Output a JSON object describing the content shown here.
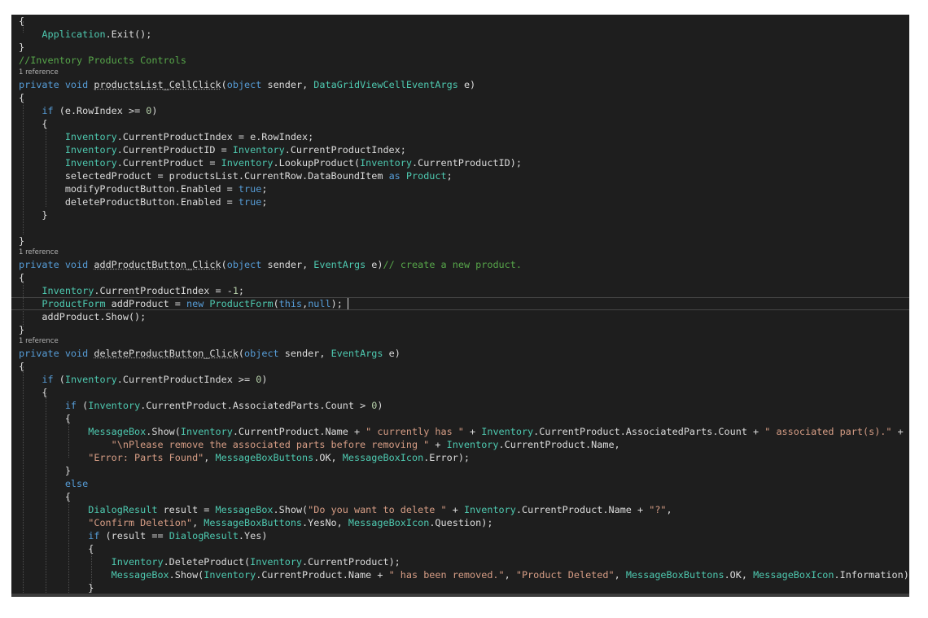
{
  "editor": {
    "references_label": "1 reference",
    "lines": [
      [
        [
          "{",
          "p"
        ]
      ],
      [
        [
          "    ",
          "p"
        ],
        [
          "Application",
          "ty"
        ],
        [
          ".Exit();",
          "p"
        ]
      ],
      [
        [
          "}",
          "p"
        ]
      ],
      [
        [
          "//Inventory Products Controls",
          "cm"
        ]
      ],
      [
        [
          "private",
          "kw"
        ],
        [
          " ",
          "p"
        ],
        [
          "void",
          "kw"
        ],
        [
          " ",
          "p"
        ],
        [
          "productsList_CellClick",
          "ul"
        ],
        [
          "(",
          "p"
        ],
        [
          "object",
          "kw"
        ],
        [
          " sender, ",
          "p"
        ],
        [
          "DataGridViewCellEventArgs",
          "ty"
        ],
        [
          " e)",
          "p"
        ]
      ],
      [
        [
          "{",
          "p"
        ]
      ],
      [
        [
          "    ",
          "p"
        ],
        [
          "if",
          "kw"
        ],
        [
          " (e.RowIndex >= ",
          "p"
        ],
        [
          "0",
          "nu"
        ],
        [
          ")",
          "p"
        ]
      ],
      [
        [
          "    {",
          "p"
        ]
      ],
      [
        [
          "        ",
          "p"
        ],
        [
          "Inventory",
          "ty"
        ],
        [
          ".CurrentProductIndex = e.RowIndex;",
          "p"
        ]
      ],
      [
        [
          "        ",
          "p"
        ],
        [
          "Inventory",
          "ty"
        ],
        [
          ".CurrentProductID = ",
          "p"
        ],
        [
          "Inventory",
          "ty"
        ],
        [
          ".CurrentProductIndex;",
          "p"
        ]
      ],
      [
        [
          "        ",
          "p"
        ],
        [
          "Inventory",
          "ty"
        ],
        [
          ".CurrentProduct = ",
          "p"
        ],
        [
          "Inventory",
          "ty"
        ],
        [
          ".LookupProduct(",
          "p"
        ],
        [
          "Inventory",
          "ty"
        ],
        [
          ".CurrentProductID);",
          "p"
        ]
      ],
      [
        [
          "        selectedProduct = productsList.CurrentRow.DataBoundItem ",
          "p"
        ],
        [
          "as",
          "kw"
        ],
        [
          " ",
          "p"
        ],
        [
          "Product",
          "ty"
        ],
        [
          ";",
          "p"
        ]
      ],
      [
        [
          "        modifyProductButton.Enabled = ",
          "p"
        ],
        [
          "true",
          "kw"
        ],
        [
          ";",
          "p"
        ]
      ],
      [
        [
          "        deleteProductButton.Enabled = ",
          "p"
        ],
        [
          "true",
          "kw"
        ],
        [
          ";",
          "p"
        ]
      ],
      [
        [
          "    }",
          "p"
        ]
      ],
      [
        [
          "",
          "p"
        ]
      ],
      [
        [
          "",
          "p"
        ]
      ],
      [
        [
          "}",
          "p"
        ]
      ],
      [
        [
          "private",
          "kw"
        ],
        [
          " ",
          "p"
        ],
        [
          "void",
          "kw"
        ],
        [
          " ",
          "p"
        ],
        [
          "addProductButton_Click",
          "ul"
        ],
        [
          "(",
          "p"
        ],
        [
          "object",
          "kw"
        ],
        [
          " sender, ",
          "p"
        ],
        [
          "EventArgs",
          "ty"
        ],
        [
          " e)",
          "p"
        ],
        [
          "// create a new product.",
          "cm"
        ]
      ],
      [
        [
          "{",
          "p"
        ]
      ],
      [
        [
          "    ",
          "p"
        ],
        [
          "Inventory",
          "ty"
        ],
        [
          ".CurrentProductIndex = -",
          "p"
        ],
        [
          "1",
          "nu"
        ],
        [
          ";",
          "p"
        ]
      ],
      [
        [
          "    ",
          "p"
        ],
        [
          "ProductForm",
          "ty"
        ],
        [
          " addProduct = ",
          "p"
        ],
        [
          "new",
          "kw"
        ],
        [
          " ",
          "p"
        ],
        [
          "ProductForm",
          "ty"
        ],
        [
          "(",
          "p"
        ],
        [
          "this",
          "kw"
        ],
        [
          ",",
          "p"
        ],
        [
          "null",
          "kw"
        ],
        [
          ");",
          "p"
        ]
      ],
      [
        [
          "    addProduct.Show();",
          "p"
        ]
      ],
      [
        [
          "}",
          "p"
        ]
      ],
      [
        [
          "private",
          "kw"
        ],
        [
          " ",
          "p"
        ],
        [
          "void",
          "kw"
        ],
        [
          " ",
          "p"
        ],
        [
          "deleteProductButton_Click",
          "ul"
        ],
        [
          "(",
          "p"
        ],
        [
          "object",
          "kw"
        ],
        [
          " sender, ",
          "p"
        ],
        [
          "EventArgs",
          "ty"
        ],
        [
          " e)",
          "p"
        ]
      ],
      [
        [
          "{",
          "p"
        ]
      ],
      [
        [
          "    ",
          "p"
        ],
        [
          "if",
          "kw"
        ],
        [
          " (",
          "p"
        ],
        [
          "Inventory",
          "ty"
        ],
        [
          ".CurrentProductIndex >= ",
          "p"
        ],
        [
          "0",
          "nu"
        ],
        [
          ")",
          "p"
        ]
      ],
      [
        [
          "    {",
          "p"
        ]
      ],
      [
        [
          "        ",
          "p"
        ],
        [
          "if",
          "kw"
        ],
        [
          " (",
          "p"
        ],
        [
          "Inventory",
          "ty"
        ],
        [
          ".CurrentProduct.AssociatedParts.Count > ",
          "p"
        ],
        [
          "0",
          "nu"
        ],
        [
          ")",
          "p"
        ]
      ],
      [
        [
          "        {",
          "p"
        ]
      ],
      [
        [
          "            ",
          "p"
        ],
        [
          "MessageBox",
          "ty"
        ],
        [
          ".Show(",
          "p"
        ],
        [
          "Inventory",
          "ty"
        ],
        [
          ".CurrentProduct.Name + ",
          "p"
        ],
        [
          "\" currently has \"",
          "st"
        ],
        [
          " + ",
          "p"
        ],
        [
          "Inventory",
          "ty"
        ],
        [
          ".CurrentProduct.AssociatedParts.Count + ",
          "p"
        ],
        [
          "\" associated part(s).\"",
          "st"
        ],
        [
          " +",
          "p"
        ]
      ],
      [
        [
          "                ",
          "p"
        ],
        [
          "\"\\nPlease remove the associated parts before removing \"",
          "st"
        ],
        [
          " + ",
          "p"
        ],
        [
          "Inventory",
          "ty"
        ],
        [
          ".CurrentProduct.Name,",
          "p"
        ]
      ],
      [
        [
          "            ",
          "p"
        ],
        [
          "\"Error: Parts Found\"",
          "st"
        ],
        [
          ", ",
          "p"
        ],
        [
          "MessageBoxButtons",
          "ty"
        ],
        [
          ".OK, ",
          "p"
        ],
        [
          "MessageBoxIcon",
          "ty"
        ],
        [
          ".Error);",
          "p"
        ]
      ],
      [
        [
          "        }",
          "p"
        ]
      ],
      [
        [
          "        ",
          "p"
        ],
        [
          "else",
          "kw"
        ]
      ],
      [
        [
          "        {",
          "p"
        ]
      ],
      [
        [
          "            ",
          "p"
        ],
        [
          "DialogResult",
          "ty"
        ],
        [
          " result = ",
          "p"
        ],
        [
          "MessageBox",
          "ty"
        ],
        [
          ".Show(",
          "p"
        ],
        [
          "\"Do you want to delete \"",
          "st"
        ],
        [
          " + ",
          "p"
        ],
        [
          "Inventory",
          "ty"
        ],
        [
          ".CurrentProduct.Name + ",
          "p"
        ],
        [
          "\"?\"",
          "st"
        ],
        [
          ",",
          "p"
        ]
      ],
      [
        [
          "            ",
          "p"
        ],
        [
          "\"Confirm Deletion\"",
          "st"
        ],
        [
          ", ",
          "p"
        ],
        [
          "MessageBoxButtons",
          "ty"
        ],
        [
          ".YesNo, ",
          "p"
        ],
        [
          "MessageBoxIcon",
          "ty"
        ],
        [
          ".Question);",
          "p"
        ]
      ],
      [
        [
          "            ",
          "p"
        ],
        [
          "if",
          "kw"
        ],
        [
          " (result == ",
          "p"
        ],
        [
          "DialogResult",
          "ty"
        ],
        [
          ".Yes)",
          "p"
        ]
      ],
      [
        [
          "            {",
          "p"
        ]
      ],
      [
        [
          "                ",
          "p"
        ],
        [
          "Inventory",
          "ty"
        ],
        [
          ".DeleteProduct(",
          "p"
        ],
        [
          "Inventory",
          "ty"
        ],
        [
          ".CurrentProduct);",
          "p"
        ]
      ],
      [
        [
          "                ",
          "p"
        ],
        [
          "MessageBox",
          "ty"
        ],
        [
          ".Show(",
          "p"
        ],
        [
          "Inventory",
          "ty"
        ],
        [
          ".CurrentProduct.Name + ",
          "p"
        ],
        [
          "\" has been removed.\"",
          "st"
        ],
        [
          ", ",
          "p"
        ],
        [
          "\"Product Deleted\"",
          "st"
        ],
        [
          ", ",
          "p"
        ],
        [
          "MessageBoxButtons",
          "ty"
        ],
        [
          ".OK, ",
          "p"
        ],
        [
          "MessageBoxIcon",
          "ty"
        ],
        [
          ".Information);",
          "p"
        ]
      ],
      [
        [
          "            }",
          "p"
        ]
      ]
    ]
  },
  "colors": {
    "background": "#1e1e1e",
    "keyword": "#569cd6",
    "type": "#4ec9b0",
    "comment": "#57a64a",
    "string": "#d69d85",
    "number": "#b5cea8",
    "plain": "#dcdcdc"
  }
}
